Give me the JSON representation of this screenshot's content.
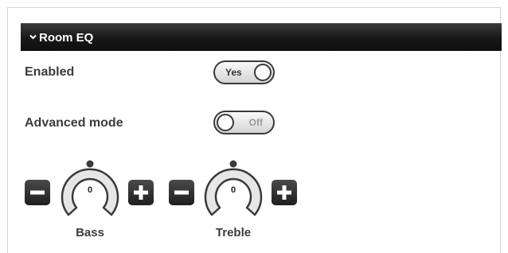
{
  "panel": {
    "title": "Room EQ",
    "collapse_icon": "chevron-down-icon"
  },
  "settings": {
    "enabled": {
      "label": "Enabled",
      "state": "Yes",
      "on": true
    },
    "advanced": {
      "label": "Advanced mode",
      "state": "Off",
      "on": false
    }
  },
  "knobs": [
    {
      "label": "Bass",
      "value": "0",
      "decrease_icon": "minus-icon",
      "increase_icon": "plus-icon"
    },
    {
      "label": "Treble",
      "value": "0",
      "decrease_icon": "minus-icon",
      "increase_icon": "plus-icon"
    }
  ],
  "colors": {
    "header_bg": "#171717",
    "button_bg": "#2a2a2a",
    "text": "#3c3c3c"
  }
}
